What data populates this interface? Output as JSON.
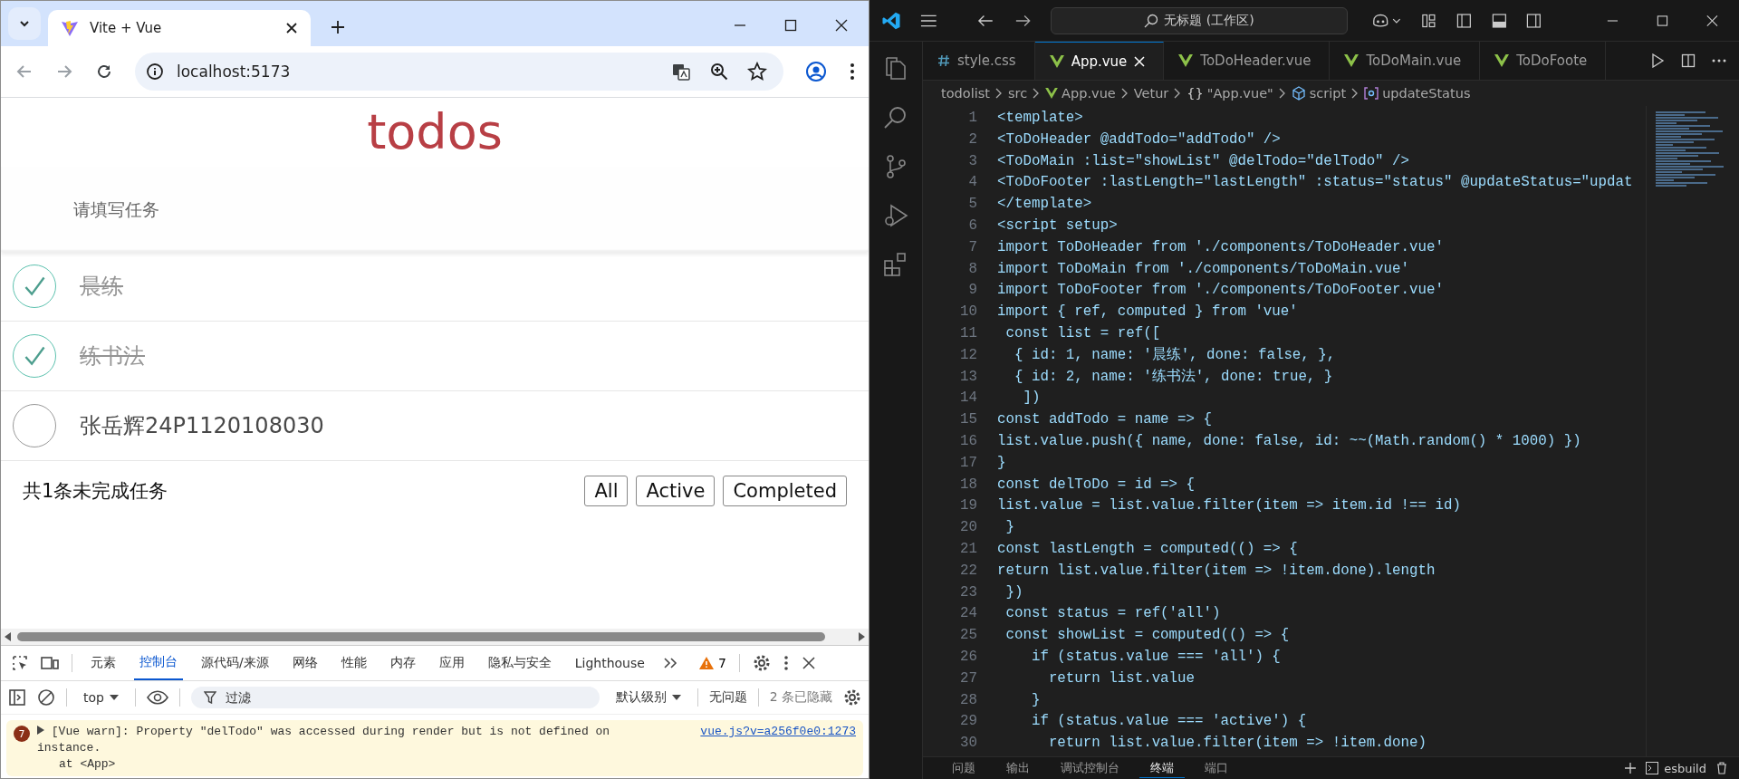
{
  "browser": {
    "tab": {
      "title": "Vite + Vue"
    },
    "address": "localhost:5173",
    "page": {
      "title": "todos",
      "input": {
        "placeholder": "请填写任务"
      },
      "todos": [
        {
          "name": "晨练",
          "done": true
        },
        {
          "name": "练书法",
          "done": true
        },
        {
          "name": "张岳辉24P1120108030",
          "done": false
        }
      ],
      "footer": {
        "count_text": "共1条未完成任务",
        "filters": [
          {
            "label": "All",
            "selected": false
          },
          {
            "label": "Active",
            "selected": false
          },
          {
            "label": "Completed",
            "selected": false
          }
        ]
      }
    },
    "devtools": {
      "tabs": [
        {
          "label": "元素",
          "selected": false
        },
        {
          "label": "控制台",
          "selected": true
        },
        {
          "label": "源代码/来源",
          "selected": false
        },
        {
          "label": "网络",
          "selected": false
        },
        {
          "label": "性能",
          "selected": false
        },
        {
          "label": "内存",
          "selected": false
        },
        {
          "label": "应用",
          "selected": false
        },
        {
          "label": "隐私与安全",
          "selected": false
        },
        {
          "label": "Lighthouse",
          "selected": false
        }
      ],
      "warning_count": "7",
      "context": "top",
      "filter": {
        "placeholder": "过滤"
      },
      "level": "默认级别",
      "issues": "无问题",
      "hidden": "2 条已隐藏",
      "messages": [
        {
          "kind": "warning",
          "count": "7",
          "text": "[Vue warn]: Property \"delTodo\" was accessed during render but is not defined on instance.",
          "trace": "at <App>",
          "source": "vue.js?v=a256f0e0:1273"
        }
      ]
    }
  },
  "editor": {
    "search": "无标题 (工作区)",
    "tabs": [
      {
        "label": "style.css",
        "kind": "css",
        "selected": false
      },
      {
        "label": "App.vue",
        "kind": "vue",
        "selected": true
      },
      {
        "label": "ToDoHeader.vue",
        "kind": "vue",
        "selected": false
      },
      {
        "label": "ToDoMain.vue",
        "kind": "vue",
        "selected": false
      },
      {
        "label": "ToDoFoote",
        "kind": "vue",
        "selected": false
      }
    ],
    "breadcrumb": [
      {
        "label": "todolist",
        "kind": "text"
      },
      {
        "label": "src",
        "kind": "text"
      },
      {
        "label": "App.vue",
        "kind": "vue"
      },
      {
        "label": "Vetur",
        "kind": "text"
      },
      {
        "label": "\"App.vue\"",
        "kind": "object",
        "icon": "{}"
      },
      {
        "label": "script",
        "kind": "module"
      },
      {
        "label": "updateStatus",
        "kind": "method"
      }
    ],
    "lines": [
      {
        "n": "1",
        "code": "<template>"
      },
      {
        "n": "2",
        "code": "<ToDoHeader @addTodo=\"addTodo\" />"
      },
      {
        "n": "3",
        "code": "<ToDoMain :list=\"showList\" @delTodo=\"delTodo\" />"
      },
      {
        "n": "4",
        "code": "<ToDoFooter :lastLength=\"lastLength\" :status=\"status\" @updateStatus=\"updat"
      },
      {
        "n": "5",
        "code": "</template>"
      },
      {
        "n": "6",
        "code": "<script setup>"
      },
      {
        "n": "7",
        "code": "import ToDoHeader from './components/ToDoHeader.vue'"
      },
      {
        "n": "8",
        "code": "import ToDoMain from './components/ToDoMain.vue'"
      },
      {
        "n": "9",
        "code": "import ToDoFooter from './components/ToDoFooter.vue'"
      },
      {
        "n": "10",
        "code": "import { ref, computed } from 'vue'"
      },
      {
        "n": "11",
        "code": " const list = ref(["
      },
      {
        "n": "12",
        "code": "  { id: 1, name: '晨练', done: false, },"
      },
      {
        "n": "13",
        "code": "  { id: 2, name: '练书法', done: true, }"
      },
      {
        "n": "14",
        "code": "   ])"
      },
      {
        "n": "15",
        "code": "const addTodo = name => {"
      },
      {
        "n": "16",
        "code": "list.value.push({ name, done: false, id: ~~(Math.random() * 1000) })"
      },
      {
        "n": "17",
        "code": "}"
      },
      {
        "n": "18",
        "code": "const delToDo = id => {"
      },
      {
        "n": "19",
        "code": "list.value = list.value.filter(item => item.id !== id)"
      },
      {
        "n": "20",
        "code": " }"
      },
      {
        "n": "21",
        "code": "const lastLength = computed(() => {"
      },
      {
        "n": "22",
        "code": "return list.value.filter(item => !item.done).length"
      },
      {
        "n": "23",
        "code": " })"
      },
      {
        "n": "24",
        "code": " const status = ref('all')"
      },
      {
        "n": "25",
        "code": " const showList = computed(() => {"
      },
      {
        "n": "26",
        "code": "    if (status.value === 'all') {"
      },
      {
        "n": "27",
        "code": "      return list.value"
      },
      {
        "n": "28",
        "code": "    }"
      },
      {
        "n": "29",
        "code": "    if (status.value === 'active') {"
      },
      {
        "n": "30",
        "code": "      return list.value.filter(item => !item.done)"
      }
    ],
    "panel_tabs": [
      {
        "label": "问题",
        "selected": false
      },
      {
        "label": "输出",
        "selected": false
      },
      {
        "label": "调试控制台",
        "selected": false
      },
      {
        "label": "终端",
        "selected": true
      },
      {
        "label": "端口",
        "selected": false
      }
    ],
    "terminal": "esbuild"
  }
}
